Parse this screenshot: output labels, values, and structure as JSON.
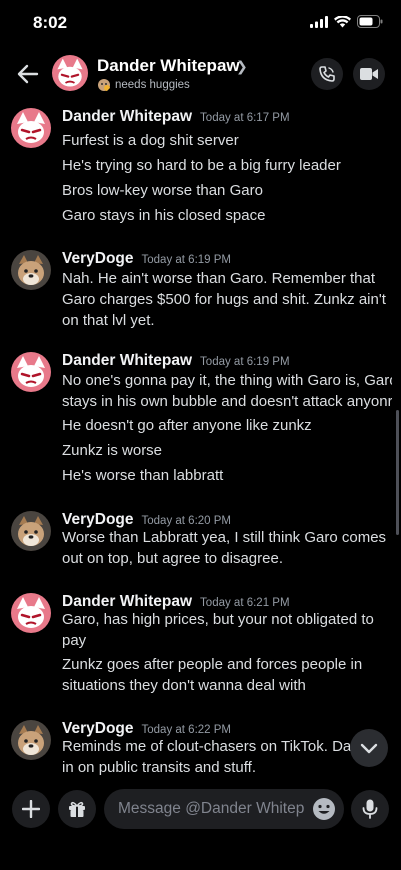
{
  "status_bar": {
    "time": "8:02"
  },
  "header": {
    "name": "Dander Whitepaw",
    "status": "needs huggies"
  },
  "composer": {
    "placeholder": "Message @Dander Whitepaw"
  },
  "colors": {
    "background": "#000000",
    "surface": "#1e1f22",
    "text": "#dbdee1",
    "muted": "#949ba4",
    "dander_avatar": "#e8798a",
    "verydoge_avatar": "#a67c52"
  },
  "messages": [
    {
      "author": "Dander Whitepaw",
      "timestamp": "Today at 6:17 PM",
      "avatar": "dander-avatar",
      "lines": [
        "Furfest is a dog shit server",
        "He's trying so hard to be a big furry leader",
        "Bros low-key worse than Garo",
        "Garo stays in his closed space"
      ]
    },
    {
      "author": "VeryDoge",
      "timestamp": "Today at 6:19 PM",
      "avatar": "verydoge-avatar",
      "lines": [
        "Nah. He ain't worse than Garo. Remember that",
        "Garo charges $500 for hugs and shit. Zunkz ain't",
        "on that lvl yet."
      ]
    },
    {
      "author": "Dander Whitepaw",
      "timestamp": "Today at 6:19 PM",
      "avatar": "dander-avatar",
      "lines": [
        "No one's gonna pay it, the thing with Garo is, Garo",
        "stays in his own bubble and doesn't attack anyonr",
        "He doesn't go after anyone like zunkz",
        "Zunkz is worse",
        "He's worse than labbratt"
      ]
    },
    {
      "author": "VeryDoge",
      "timestamp": "Today at 6:20 PM",
      "avatar": "verydoge-avatar",
      "lines": [
        "Worse than Labbratt yea, I still think Garo comes",
        "out on top, but agree to disagree."
      ]
    },
    {
      "author": "Dander Whitepaw",
      "timestamp": "Today at 6:21 PM",
      "avatar": "dander-avatar",
      "lines": [
        "Garo, has high prices, but your not obligated to",
        "pay",
        "Zunkz goes after people and forces people in",
        "situations they don't wanna deal with"
      ]
    },
    {
      "author": "VeryDoge",
      "timestamp": "Today at 6:22 PM",
      "avatar": "verydoge-avatar",
      "lines": [
        "Reminds me of clout-chasers on TikTok. Dan",
        "in on public transits and stuff."
      ]
    }
  ]
}
